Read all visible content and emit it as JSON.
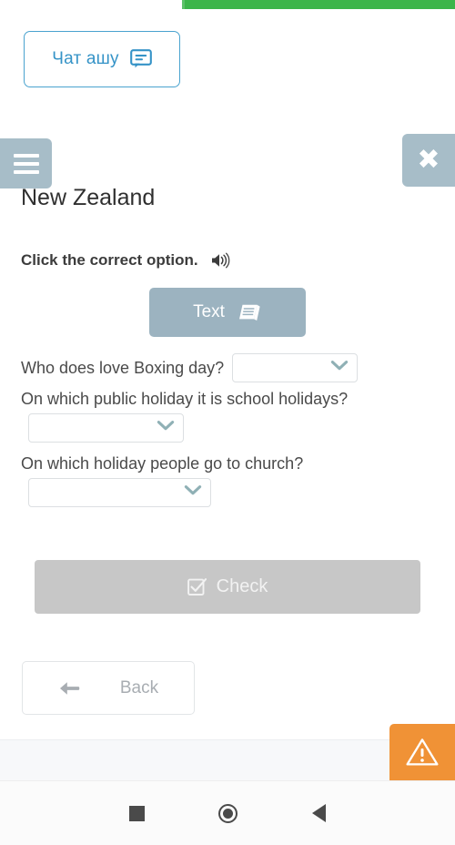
{
  "colors": {
    "progress_green": "#3cb54a",
    "chat_blue": "#3593c7",
    "header_btn_gray_blue": "#a7bdc8",
    "text_btn_gray_blue": "#9cb3c0",
    "check_btn_gray": "#c7c7c7",
    "warning_orange": "#f09236",
    "question_text": "#4a4a4a",
    "dropdown_border": "#dcdfe2",
    "caret_teal": "#8fb0b5"
  },
  "top_bar": {
    "progress_label": "",
    "progress_percent": 60
  },
  "chat_widget": {
    "label": "Чат ашу",
    "icon": "chat-bubble-icon"
  },
  "lesson_header": {
    "menu_icon": "hamburger-icon",
    "close_icon": "close-icon",
    "title": "New Zealand"
  },
  "instruction": {
    "text": "Click the correct option.",
    "audio_icon": "speaker-icon"
  },
  "material_button": {
    "label": "Text",
    "icon": "book-icon"
  },
  "questions": [
    {
      "text": "Who does love Boxing day?",
      "answer_value": "",
      "placeholder": "",
      "layout": "inline",
      "dropdown_icon": "chevron-down-icon"
    },
    {
      "text": "On which public holiday it is school holidays?",
      "answer_value": "",
      "placeholder": "",
      "layout": "below",
      "dropdown_icon": "chevron-down-icon"
    },
    {
      "text": "On which holiday people go to church?",
      "answer_value": "",
      "placeholder": "",
      "layout": "below",
      "dropdown_icon": "chevron-down-icon"
    }
  ],
  "check_button": {
    "label": "Check",
    "icon": "check-square-icon",
    "disabled": true
  },
  "back_button": {
    "label": "Back",
    "icon": "arrow-left-icon"
  },
  "warning_fab": {
    "icon": "warning-triangle-icon",
    "label": ""
  },
  "navbar": {
    "recents_icon": "square-icon",
    "home_icon": "circle-icon",
    "back_icon": "triangle-left-icon"
  }
}
